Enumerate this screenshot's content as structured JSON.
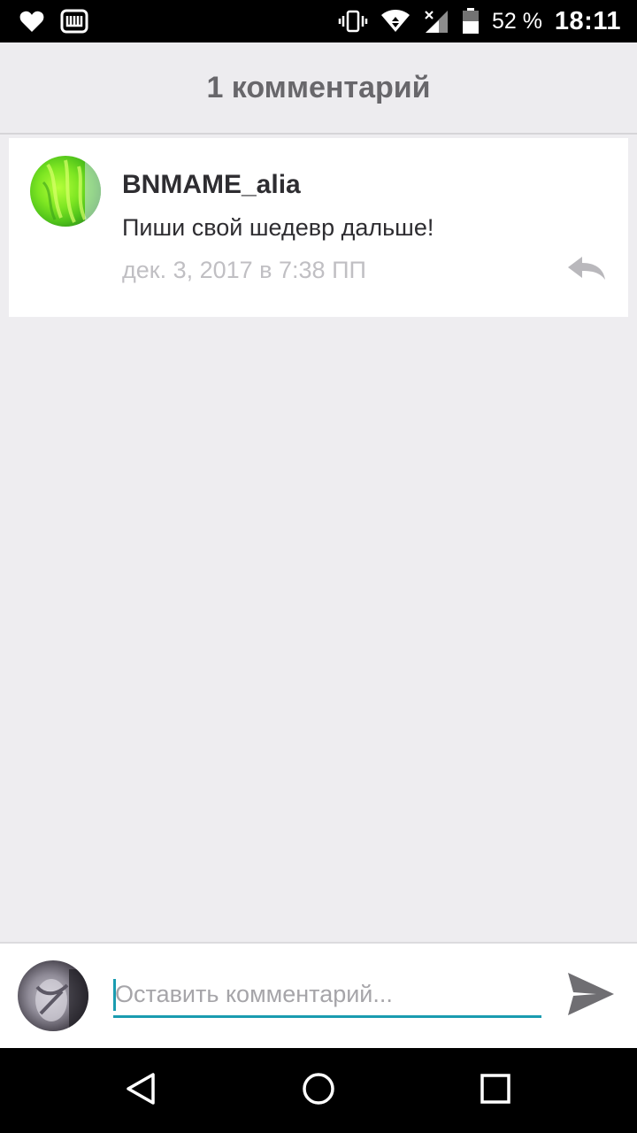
{
  "status_bar": {
    "battery_percent": "52 %",
    "time": "18:11",
    "icons": [
      "heart-icon",
      "wattpad-w-icon",
      "vibrate-icon",
      "wifi-icon",
      "signal-icon",
      "battery-icon"
    ]
  },
  "header": {
    "title": "1 комментарий"
  },
  "comments": [
    {
      "author": "BNMAME_alia",
      "text": "Пиши свой шедевр дальше!",
      "time": "дек. 3, 2017 в 7:38 ПП",
      "reply_icon": "reply-icon"
    }
  ],
  "input_bar": {
    "placeholder": "Оставить комментарий...",
    "value": "",
    "send_icon": "send-icon"
  },
  "nav_bar": {
    "icons": [
      "back-icon",
      "home-icon",
      "recents-icon"
    ]
  },
  "colors": {
    "accent": "#1a9cb0",
    "background": "#eeedf0",
    "header_text": "#68676b",
    "muted_text": "#c0bfc3"
  }
}
